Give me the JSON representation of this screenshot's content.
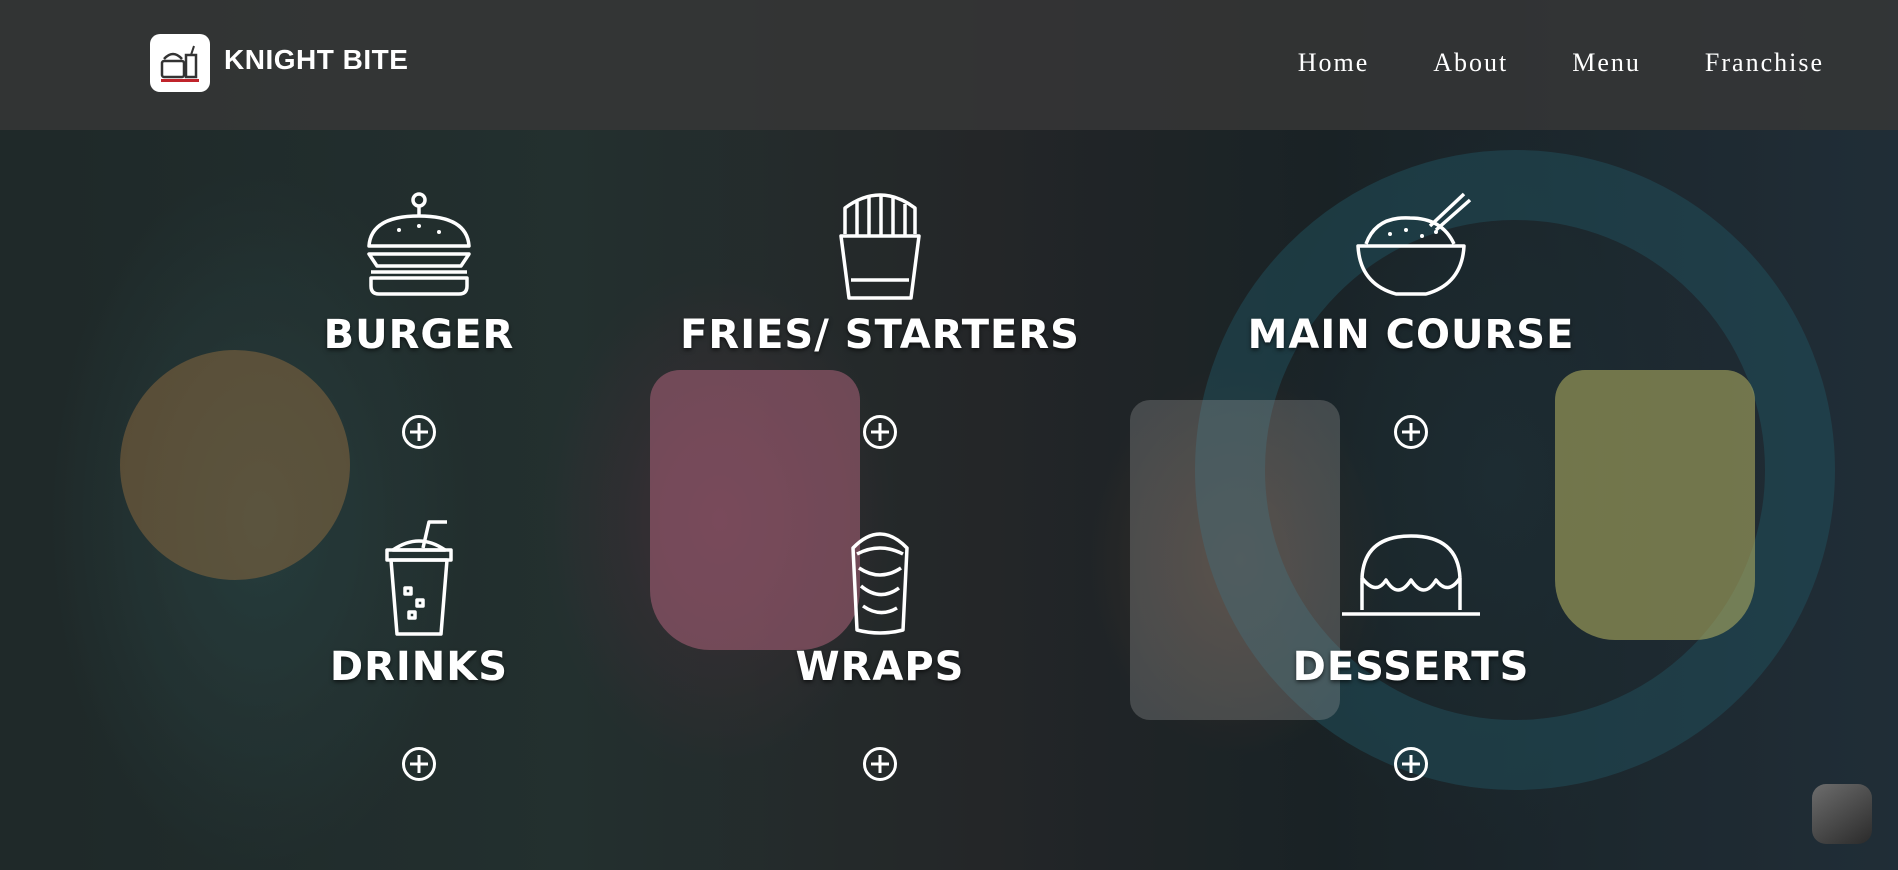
{
  "brand": {
    "name": "KNIGHT BITE",
    "logo_icon": "knight-bite-logo"
  },
  "nav": [
    {
      "label": "Home"
    },
    {
      "label": "About"
    },
    {
      "label": "Menu"
    },
    {
      "label": "Franchise"
    }
  ],
  "categories": [
    {
      "label": "BURGER",
      "icon": "burger-icon"
    },
    {
      "label": "FRIES/ STARTERS",
      "icon": "fries-icon"
    },
    {
      "label": "MAIN COURSE",
      "icon": "rice-bowl-icon"
    },
    {
      "label": "DRINKS",
      "icon": "drink-cup-icon"
    },
    {
      "label": "WRAPS",
      "icon": "wrap-icon"
    },
    {
      "label": "DESSERTS",
      "icon": "dessert-icon"
    }
  ]
}
